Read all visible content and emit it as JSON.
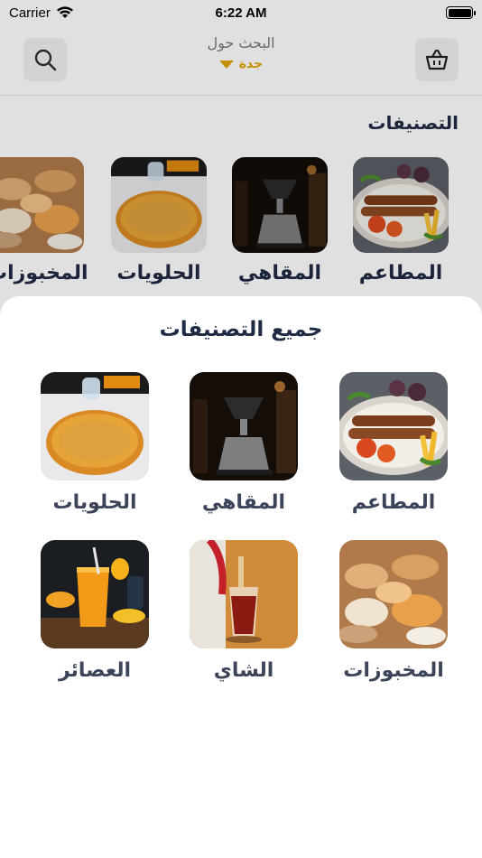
{
  "status_bar": {
    "carrier": "Carrier",
    "time": "6:22 AM"
  },
  "header": {
    "search_label": "البحث حول",
    "city": "جدة",
    "search_icon": "search-icon",
    "basket_icon": "basket-icon"
  },
  "categories_section": {
    "title": "التصنيفات",
    "items": [
      {
        "label": "المطاعم",
        "image": "grilled-food-platter"
      },
      {
        "label": "المقاهي",
        "image": "coffee-pourover"
      },
      {
        "label": "الحلويات",
        "image": "kunafa-dessert"
      },
      {
        "label": "المخبوزات",
        "image": "pastries"
      }
    ]
  },
  "sheet": {
    "title": "جميع التصنيفات",
    "items": [
      {
        "label": "المطاعم",
        "image": "grilled-food-platter"
      },
      {
        "label": "المقاهي",
        "image": "coffee-pourover"
      },
      {
        "label": "الحلويات",
        "image": "kunafa-dessert"
      },
      {
        "label": "المخبوزات",
        "image": "pastries"
      },
      {
        "label": "الشاي",
        "image": "tea-glass"
      },
      {
        "label": "العصائر",
        "image": "mango-juice"
      }
    ]
  },
  "colors": {
    "accent": "#e0a400",
    "text": "#1f2a44"
  }
}
